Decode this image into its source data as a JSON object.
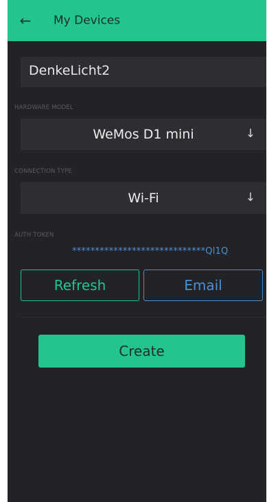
{
  "header": {
    "back_icon": "arrow-left-icon",
    "title": "My Devices",
    "background": "#23c48e"
  },
  "device": {
    "name": "DenkeLicht2"
  },
  "hardware": {
    "label": "HARDWARE MODEL",
    "selected": "WeMos D1 mini",
    "arrow": "↓"
  },
  "connection": {
    "label": "CONNECTION TYPE",
    "selected": "Wi-Fi",
    "arrow": "↓"
  },
  "auth": {
    "label": "AUTH TOKEN",
    "token": "*****************************Ql1Q"
  },
  "buttons": {
    "refresh": "Refresh",
    "email": "Email",
    "create": "Create"
  },
  "colors": {
    "accent_green": "#23c48e",
    "accent_blue": "#4a90d9",
    "background": "#222326",
    "field": "#2d2e31"
  }
}
